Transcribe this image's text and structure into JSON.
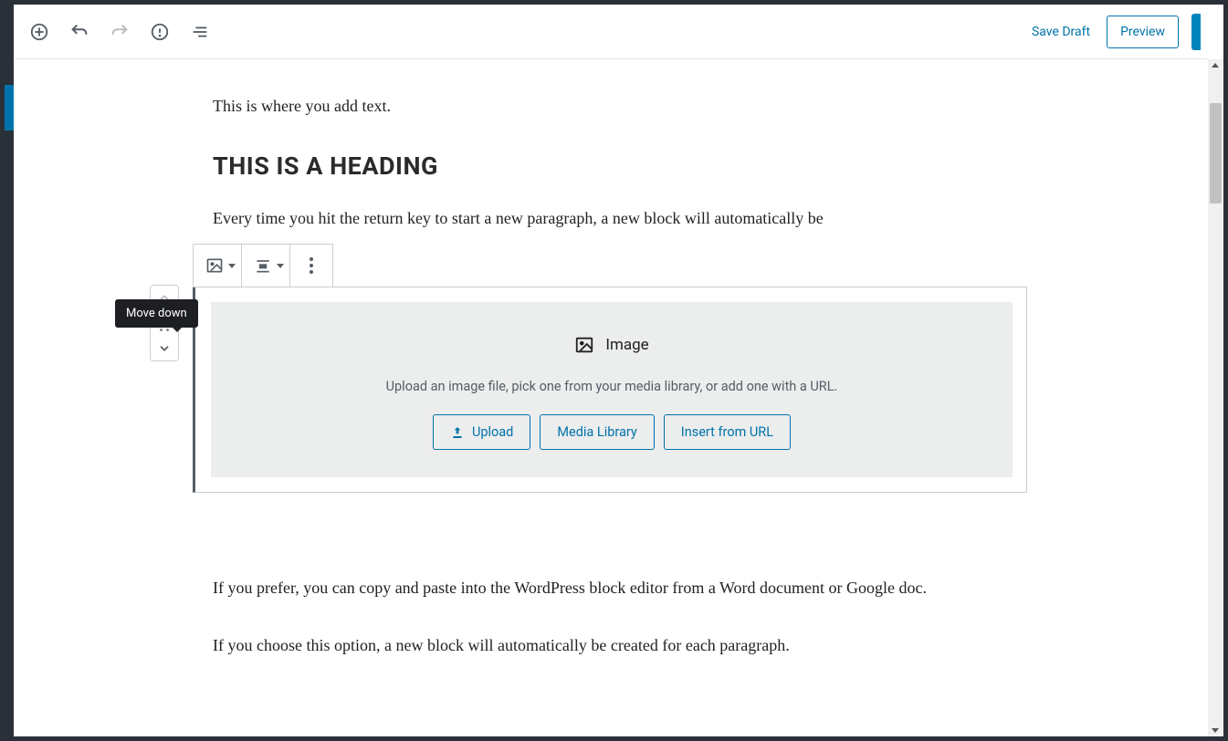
{
  "toolbar": {
    "save_draft": "Save Draft",
    "preview": "Preview"
  },
  "content": {
    "p1": "This is where you add text.",
    "h2": "THIS IS A HEADING",
    "p2": "Every time you hit the return key to start a new paragraph, a new block will automatically be",
    "p3": "If you prefer,  you can copy and paste into the WordPress block editor from a Word document or Google doc.",
    "p4": "If you choose this option, a new block will automatically be created for each paragraph."
  },
  "image_block": {
    "title": "Image",
    "description": "Upload an image file, pick one from your media library, or add one with a URL.",
    "upload_label": "Upload",
    "media_library_label": "Media Library",
    "insert_url_label": "Insert from URL"
  },
  "tooltip": {
    "move_down": "Move down"
  }
}
